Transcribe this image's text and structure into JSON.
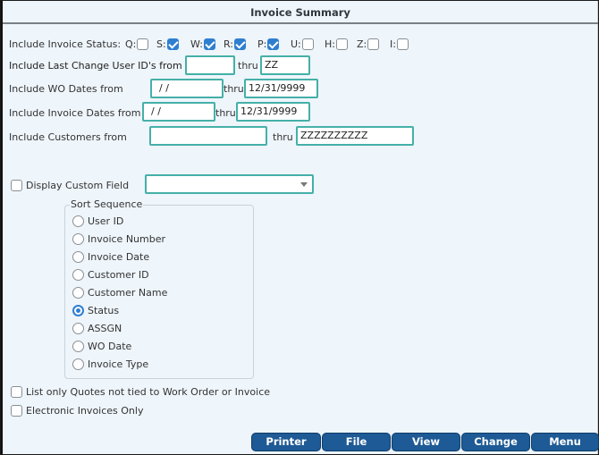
{
  "window": {
    "title": "Invoice Summary"
  },
  "status_filter": {
    "label": "Include Invoice Status:",
    "items": [
      {
        "code": "Q:",
        "checked": false
      },
      {
        "code": "S:",
        "checked": true
      },
      {
        "code": "W:",
        "checked": true
      },
      {
        "code": "R:",
        "checked": true
      },
      {
        "code": "P:",
        "checked": true
      },
      {
        "code": "U:",
        "checked": false
      },
      {
        "code": "H:",
        "checked": false
      },
      {
        "code": "Z:",
        "checked": false
      },
      {
        "code": "I:",
        "checked": false
      }
    ]
  },
  "ranges": {
    "user_id": {
      "label": "Include Last Change User ID's from",
      "from": "",
      "thru_label": "thru",
      "thru": "ZZ"
    },
    "wo_dates": {
      "label": "Include WO Dates from",
      "from": " /  /",
      "thru_label": "thru",
      "thru": "12/31/9999"
    },
    "invoice_dates": {
      "label": "Include Invoice Dates from",
      "from": " /  /",
      "thru_label": "thru",
      "thru": "12/31/9999"
    },
    "customers": {
      "label": "Include Customers from",
      "from": "",
      "thru_label": "thru",
      "thru": "ZZZZZZZZZZ"
    }
  },
  "custom_field": {
    "label": "Display Custom Field",
    "checked": false,
    "selected": ""
  },
  "sort_sequence": {
    "legend": "Sort Sequence",
    "selected": "Status",
    "options": [
      "User ID",
      "Invoice Number",
      "Invoice Date",
      "Customer ID",
      "Customer Name",
      "Status",
      "ASSGN",
      "WO Date",
      "Invoice Type"
    ]
  },
  "options": {
    "quotes_only": {
      "label": "List only Quotes not tied to Work Order or Invoice",
      "checked": false
    },
    "electronic_only": {
      "label": "Electronic Invoices Only",
      "checked": false
    }
  },
  "buttons": {
    "printer": "Printer",
    "file": "File",
    "view": "View",
    "change": "Change",
    "menu": "Menu"
  },
  "colors": {
    "accent": "#2f7fd1",
    "input_border": "#45b0a8",
    "button_bg": "#1e5a95",
    "background": "#eef5fb"
  }
}
